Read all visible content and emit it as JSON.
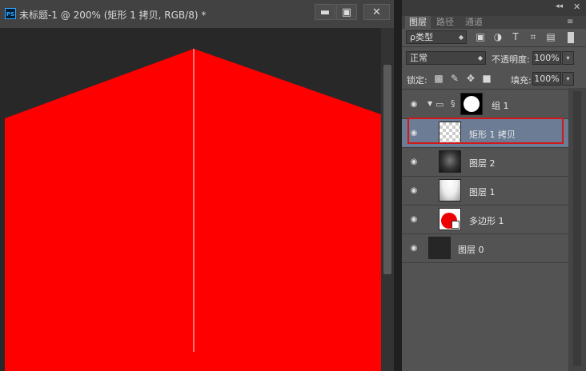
{
  "document": {
    "title": "未标题-1 @ 200% (矩形 1 拷贝, RGB/8) *",
    "app_icon": "PS",
    "buttons": {
      "minimize": "▬",
      "maximize": "▣",
      "close": "✕"
    },
    "canvas_color": "#ff0000",
    "center_line_color": "#ff9a9a",
    "background_color": "#282828"
  },
  "panel": {
    "collapse": "◂◂",
    "close": "✕",
    "menu": "≡",
    "tabs": [
      {
        "label": "图层",
        "active": true
      },
      {
        "label": "路径",
        "active": false
      },
      {
        "label": "通道",
        "active": false
      }
    ],
    "filter": {
      "label": "ρ类型",
      "icons": [
        "image-filter-icon",
        "adjustment-filter-icon",
        "type-filter-icon",
        "shape-filter-icon",
        "smart-object-filter-icon"
      ]
    },
    "blend_mode": "正常",
    "opacity": {
      "label": "不透明度:",
      "value": "100%"
    },
    "lock": {
      "label": "锁定:",
      "icons": [
        "lock-transparent-icon",
        "lock-paint-icon",
        "lock-move-icon",
        "lock-all-icon"
      ]
    },
    "fill": {
      "label": "填充:",
      "value": "100%"
    },
    "layers": [
      {
        "name": "组 1",
        "type": "group",
        "selected": false,
        "thumb": "white-circle-mask"
      },
      {
        "name": "矩形 1 拷贝",
        "type": "shape",
        "selected": true,
        "thumb": "transparent"
      },
      {
        "name": "图层 2",
        "type": "pixel",
        "selected": false,
        "thumb": "dark-gradient"
      },
      {
        "name": "图层 1",
        "type": "pixel",
        "selected": false,
        "thumb": "light-gradient"
      },
      {
        "name": "多边形 1",
        "type": "shape",
        "selected": false,
        "thumb": "red-circle"
      },
      {
        "name": "图层 0",
        "type": "pixel",
        "selected": false,
        "thumb": "dark"
      }
    ]
  }
}
